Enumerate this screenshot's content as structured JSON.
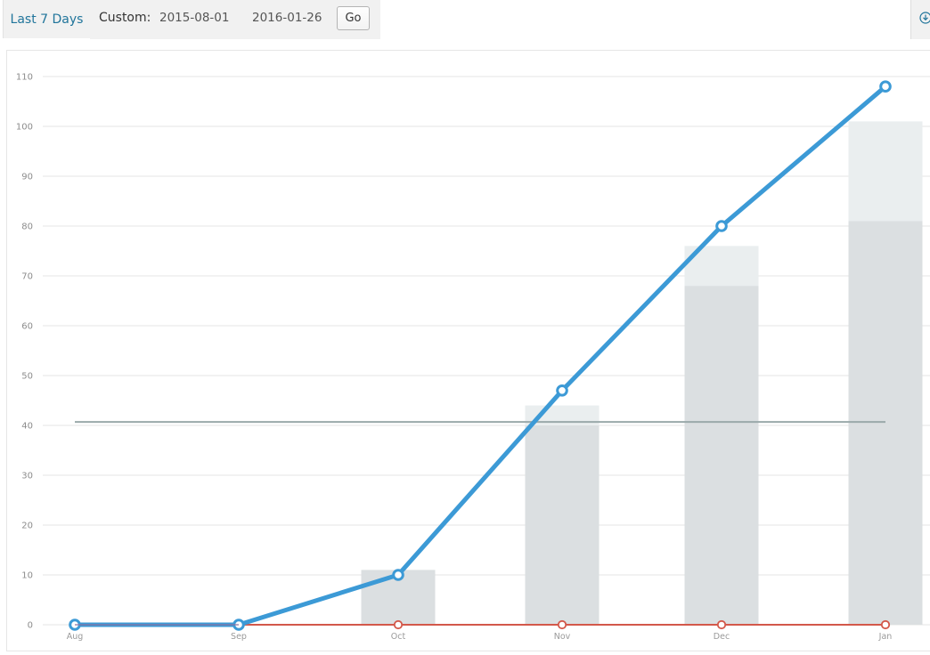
{
  "toolbar": {
    "last7_label": "Last 7 Days",
    "custom_label": "Custom:",
    "start_date": "2015-08-01",
    "end_date": "2016-01-26",
    "go_label": "Go"
  },
  "icons": {
    "download": "download-circle-icon"
  },
  "colors": {
    "line_primary": "#3c9ad6",
    "line_zero": "#d3584a",
    "average_line": "#9aa9aa",
    "bar_dark": "#dbdfe1",
    "bar_light": "#eaeeef",
    "active_tab_text": "#21759b"
  },
  "chart_data": {
    "type": "bar",
    "categories": [
      "Aug",
      "Sep",
      "Oct",
      "Nov",
      "Dec",
      "Jan"
    ],
    "ylim": [
      0,
      110
    ],
    "yticks": [
      0,
      10,
      20,
      30,
      40,
      50,
      60,
      70,
      80,
      90,
      100,
      110
    ],
    "grid": true,
    "series": [
      {
        "kind": "bar-bottom",
        "values": [
          0,
          0,
          11,
          40,
          68,
          81
        ]
      },
      {
        "kind": "bar-top",
        "values": [
          0,
          0,
          11,
          44,
          76,
          101
        ]
      },
      {
        "kind": "line",
        "values": [
          0,
          0,
          10,
          47,
          80,
          108
        ]
      },
      {
        "kind": "line",
        "values": [
          0,
          0,
          0,
          0,
          0,
          0
        ]
      },
      {
        "kind": "reference-line",
        "values": [
          40.7,
          40.7,
          40.7,
          40.7,
          40.7,
          40.7
        ]
      }
    ]
  }
}
